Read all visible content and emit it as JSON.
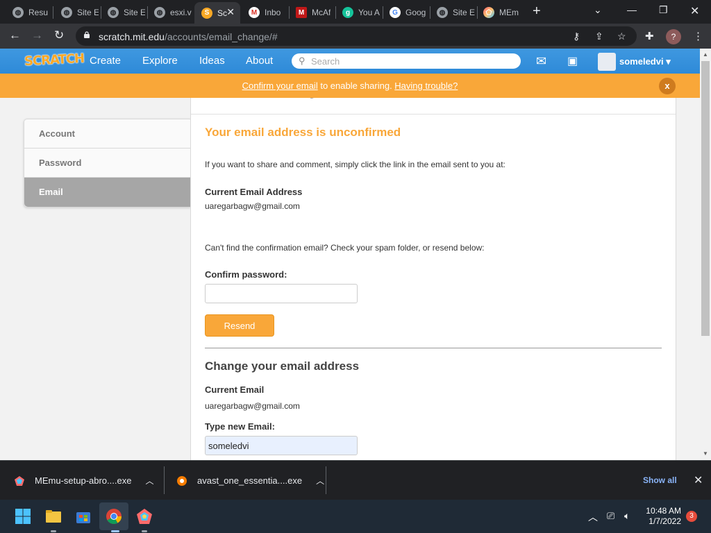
{
  "browser": {
    "tabs": [
      {
        "title": "Resu",
        "icon": "globe-icon"
      },
      {
        "title": "Site E",
        "icon": "globe-icon"
      },
      {
        "title": "Site E",
        "icon": "globe-icon"
      },
      {
        "title": "esxi.v",
        "icon": "globe-icon"
      },
      {
        "title": "Sc",
        "icon": "scratch-icon",
        "active": true
      },
      {
        "title": "Inbo",
        "icon": "gmail-icon"
      },
      {
        "title": "McAf",
        "icon": "mcafee-icon"
      },
      {
        "title": "You A",
        "icon": "grammarly-icon"
      },
      {
        "title": "Goog",
        "icon": "google-icon"
      },
      {
        "title": "Site E",
        "icon": "globe-icon"
      },
      {
        "title": "MEm",
        "icon": "memu-icon"
      }
    ],
    "url_domain": "scratch.mit.edu",
    "url_path": "/accounts/email_change/#",
    "profile_initial": "?"
  },
  "scratch_nav": {
    "logo": "SCRATCH",
    "links": [
      "Create",
      "Explore",
      "Ideas",
      "About"
    ],
    "search_placeholder": "Search",
    "username": "someledvi"
  },
  "banner": {
    "link1": "Confirm your email",
    "middle": " to enable sharing. ",
    "link2": "Having trouble?",
    "close": "x"
  },
  "sidebar": {
    "items": [
      {
        "label": "Account"
      },
      {
        "label": "Password"
      },
      {
        "label": "Email",
        "selected": true
      }
    ]
  },
  "main": {
    "page_title": "Account Settings",
    "unconfirmed_heading": "Your email address is unconfirmed",
    "share_text": "If you want to share and comment, simply click the link in the email sent to you at:",
    "current_email_label": "Current Email Address",
    "current_email_value": "uaregarbagw@gmail.com",
    "spam_text": "Can't find the confirmation email? Check your spam folder, or resend below:",
    "confirm_password_label": "Confirm password:",
    "confirm_password_value": "",
    "resend_label": "Resend",
    "change_heading": "Change your email address",
    "current_email_label2": "Current Email",
    "current_email_value2": "uaregarbagw@gmail.com",
    "new_email_label": "Type new Email:",
    "new_email_value": "someledvi"
  },
  "downloads": {
    "items": [
      {
        "name": "MEmu-setup-abro....exe",
        "icon": "memu-icon"
      },
      {
        "name": "avast_one_essentia....exe",
        "icon": "avast-icon"
      }
    ],
    "show_all": "Show all"
  },
  "taskbar": {
    "time": "10:48 AM",
    "date": "1/7/2022",
    "notifications": "3"
  }
}
